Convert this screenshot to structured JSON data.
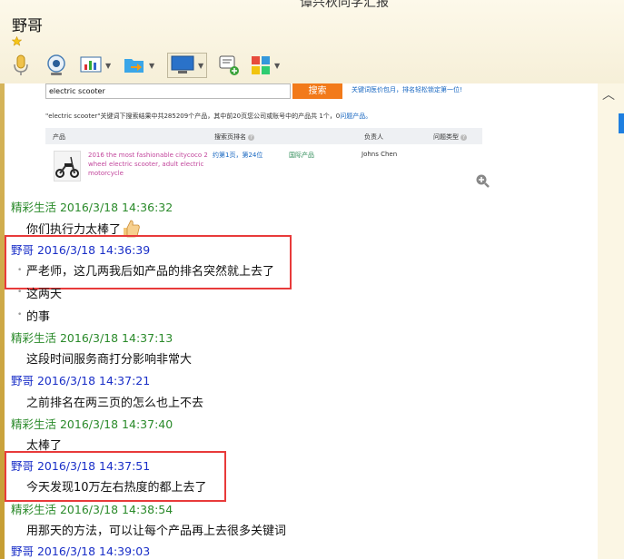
{
  "window": {
    "title": "谭兴秋同学汇报"
  },
  "header": {
    "contact_name": "野哥"
  },
  "toolbar": {
    "items": [
      "voice-icon",
      "video-icon",
      "screen-icon",
      "file-icon",
      "remote-icon",
      "add-note-icon",
      "apps-icon"
    ]
  },
  "embed": {
    "search_value": "electric scooter",
    "search_button": "搜索",
    "promo_text": "关键词医价包月，排名轻松锁定第一位!",
    "result_prefix": "\"electric scooter\"关键词下搜索结果中共285209个产品，其中前20页您公司或账号中的产品共 1个，0",
    "result_link": "问题产品。",
    "columns": [
      "产品",
      "搜索页排名",
      "负责人",
      "问题类型"
    ],
    "product_title": "2016 the most fashionable citycoco 2 wheel electric scooter, adult electric motorcycle",
    "rank": "约第1页，第24位",
    "market": "国际产品",
    "person": "Johns Chen"
  },
  "messages": [
    {
      "meta": "精彩生活 2016/3/18 14:36:32",
      "sender": "other"
    },
    {
      "text": "你们执行力太棒了"
    },
    {
      "meta": "野哥 2016/3/18 14:36:39",
      "sender": "me"
    },
    {
      "text": "严老师，这几两我后如产品的排名突然就上去了"
    },
    {
      "text": "这两天"
    },
    {
      "text": "的事"
    },
    {
      "meta": "精彩生活 2016/3/18 14:37:13",
      "sender": "other"
    },
    {
      "text": "这段时间服务商打分影响非常大"
    },
    {
      "meta": "野哥 2016/3/18 14:37:21",
      "sender": "me"
    },
    {
      "text": "之前排名在两三页的怎么也上不去"
    },
    {
      "meta": "精彩生活 2016/3/18 14:37:40",
      "sender": "other"
    },
    {
      "text": "太棒了"
    },
    {
      "meta": "野哥 2016/3/18 14:37:51",
      "sender": "me"
    },
    {
      "text": "今天发现10万左右热度的都上去了"
    },
    {
      "meta": "精彩生活 2016/3/18 14:38:54",
      "sender": "other"
    },
    {
      "text": "用那天的方法，可以让每个产品再上去很多关键词"
    },
    {
      "meta": "野哥 2016/3/18 14:39:03",
      "sender": "me"
    }
  ],
  "colors": {
    "highlight_border": "#e83a3a",
    "me_meta": "#1a2fc8",
    "other_meta": "#2a8a2a"
  }
}
